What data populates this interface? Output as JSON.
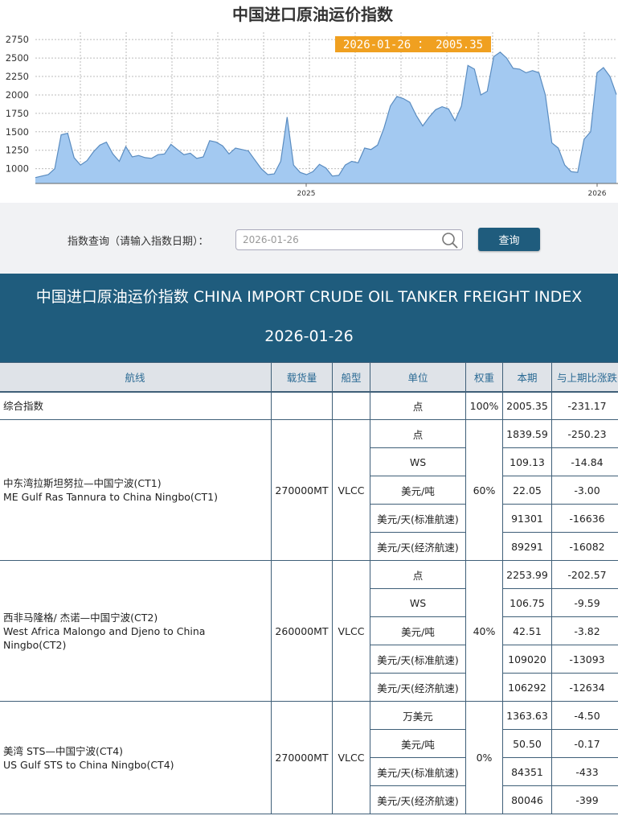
{
  "chart_data": {
    "type": "area",
    "title": "中国进口原油运价指数",
    "tooltip": "2026-01-26 ： 2005.35",
    "xlabel": "",
    "ylabel": "",
    "ylim": [
      800,
      2850
    ],
    "y_ticks": [
      1000,
      1250,
      1500,
      1750,
      2000,
      2250,
      2500,
      2750
    ],
    "x_tick_labels": [
      "2025",
      "2026"
    ],
    "fill_color": "#a3c9f1",
    "line_color": "#5a8cc0",
    "values": [
      880,
      900,
      920,
      1000,
      1460,
      1480,
      1150,
      1050,
      1110,
      1230,
      1320,
      1360,
      1200,
      1100,
      1300,
      1160,
      1180,
      1150,
      1140,
      1190,
      1200,
      1330,
      1260,
      1190,
      1210,
      1140,
      1160,
      1380,
      1360,
      1310,
      1200,
      1280,
      1260,
      1240,
      1120,
      1000,
      920,
      930,
      1100,
      1700,
      1050,
      950,
      920,
      960,
      1060,
      1010,
      900,
      910,
      1050,
      1100,
      1080,
      1280,
      1260,
      1320,
      1550,
      1850,
      1980,
      1950,
      1900,
      1720,
      1580,
      1700,
      1800,
      1840,
      1810,
      1650,
      1850,
      2400,
      2350,
      2000,
      2050,
      2520,
      2580,
      2500,
      2360,
      2350,
      2300,
      2330,
      2300,
      2000,
      1350,
      1280,
      1050,
      960,
      950,
      1400,
      1500,
      2300,
      2370,
      2250,
      2005
    ]
  },
  "query": {
    "label": "指数查询（请输入指数日期）：",
    "value": "2026-01-26",
    "button": "查询"
  },
  "header": {
    "title": "中国进口原油运价指数 CHINA IMPORT CRUDE OIL TANKER FREIGHT INDEX",
    "date": "2026-01-26"
  },
  "table": {
    "columns": [
      "航线",
      "载货量",
      "船型",
      "单位",
      "权重",
      "本期",
      "与上期比涨跌"
    ],
    "composite": {
      "name": "综合指数",
      "cargo": "",
      "ship": "",
      "unit": "点",
      "weight": "100%",
      "current": "2005.35",
      "change": "-231.17"
    },
    "routes": [
      {
        "name_cn": "中东湾拉斯坦努拉—中国宁波(CT1)",
        "name_en": "ME Gulf Ras Tannura to China Ningbo(CT1)",
        "cargo": "270000MT",
        "ship": "VLCC",
        "weight": "60%",
        "rows": [
          {
            "unit": "点",
            "current": "1839.59",
            "change": "-250.23"
          },
          {
            "unit": "WS",
            "current": "109.13",
            "change": "-14.84"
          },
          {
            "unit": "美元/吨",
            "current": "22.05",
            "change": "-3.00"
          },
          {
            "unit": "美元/天(标准航速)",
            "current": "91301",
            "change": "-16636"
          },
          {
            "unit": "美元/天(经济航速)",
            "current": "89291",
            "change": "-16082"
          }
        ]
      },
      {
        "name_cn": "西非马隆格/ 杰诺—中国宁波(CT2)",
        "name_en": "West Africa Malongo and Djeno to China Ningbo(CT2)",
        "cargo": "260000MT",
        "ship": "VLCC",
        "weight": "40%",
        "rows": [
          {
            "unit": "点",
            "current": "2253.99",
            "change": "-202.57"
          },
          {
            "unit": "WS",
            "current": "106.75",
            "change": "-9.59"
          },
          {
            "unit": "美元/吨",
            "current": "42.51",
            "change": "-3.82"
          },
          {
            "unit": "美元/天(标准航速)",
            "current": "109020",
            "change": "-13093"
          },
          {
            "unit": "美元/天(经济航速)",
            "current": "106292",
            "change": "-12634"
          }
        ]
      },
      {
        "name_cn": "美湾 STS—中国宁波(CT4)",
        "name_en": "US Gulf STS to China Ningbo(CT4)",
        "cargo": "270000MT",
        "ship": "VLCC",
        "weight": "0%",
        "rows": [
          {
            "unit": "万美元",
            "current": "1363.63",
            "change": "-4.50"
          },
          {
            "unit": "美元/吨",
            "current": "50.50",
            "change": "-0.17"
          },
          {
            "unit": "美元/天(标准航速)",
            "current": "84351",
            "change": "-433"
          },
          {
            "unit": "美元/天(经济航速)",
            "current": "80046",
            "change": "-399"
          }
        ]
      }
    ]
  }
}
